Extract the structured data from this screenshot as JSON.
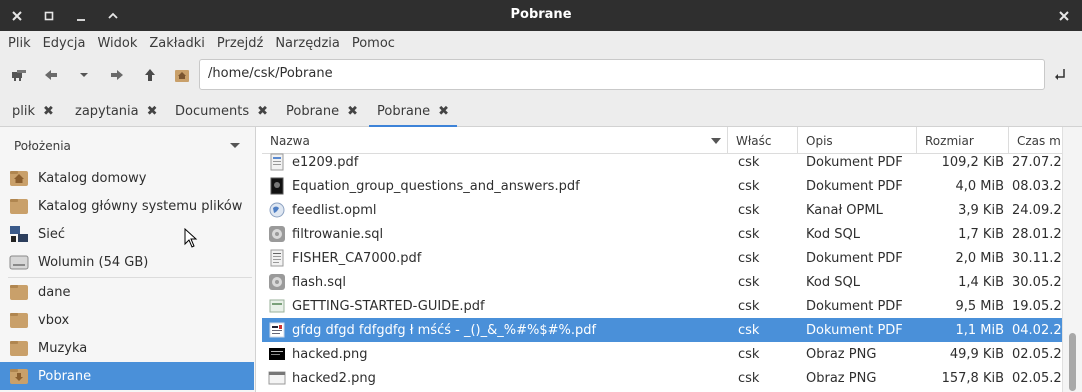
{
  "window": {
    "title": "Pobrane"
  },
  "menu": [
    "Plik",
    "Edycja",
    "Widok",
    "Zakładki",
    "Przejdź",
    "Narzędzia",
    "Pomoc"
  ],
  "location": {
    "path": "/home/csk/Pobrane"
  },
  "tabs": [
    {
      "label": "plik",
      "active": false
    },
    {
      "label": "zapytania",
      "active": false
    },
    {
      "label": "Documents",
      "active": false
    },
    {
      "label": "Pobrane",
      "active": false
    },
    {
      "label": "Pobrane",
      "active": true
    }
  ],
  "sidebar": {
    "header": "Położenia",
    "items": [
      {
        "label": "Katalog domowy",
        "icon": "home-folder-icon"
      },
      {
        "label": "Katalog główny systemu plików",
        "icon": "folder-icon"
      },
      {
        "label": "Sieć",
        "icon": "network-icon"
      },
      {
        "label": "Wolumin (54 GB)",
        "icon": "drive-icon"
      },
      {
        "label": "dane",
        "icon": "folder-icon"
      },
      {
        "label": "vbox",
        "icon": "folder-icon"
      },
      {
        "label": "Muzyka",
        "icon": "folder-icon"
      },
      {
        "label": "Pobrane",
        "icon": "download-folder-icon",
        "selected": true
      }
    ]
  },
  "columns": {
    "name": "Nazwa",
    "owner": "Właśc",
    "desc": "Opis",
    "size": "Rozmiar",
    "date": "Czas m"
  },
  "files": [
    {
      "name": "e1209.pdf",
      "owner": "csk",
      "desc": "Dokument PDF",
      "size": "109,2 KiB",
      "date": "27.07.2",
      "icon": "pdf-icon"
    },
    {
      "name": "Equation_group_questions_and_answers.pdf",
      "owner": "csk",
      "desc": "Dokument PDF",
      "size": "4,0 MiB",
      "date": "08.03.2",
      "icon": "pdf-dark-icon"
    },
    {
      "name": "feedlist.opml",
      "owner": "csk",
      "desc": "Kanał OPML",
      "size": "3,9 KiB",
      "date": "24.09.2",
      "icon": "globe-icon"
    },
    {
      "name": "filtrowanie.sql",
      "owner": "csk",
      "desc": "Kod SQL",
      "size": "1,7 KiB",
      "date": "28.01.2",
      "icon": "sql-icon"
    },
    {
      "name": "FISHER_CA7000.pdf",
      "owner": "csk",
      "desc": "Dokument PDF",
      "size": "2,0 MiB",
      "date": "30.11.2",
      "icon": "pdf-icon"
    },
    {
      "name": "flash.sql",
      "owner": "csk",
      "desc": "Kod SQL",
      "size": "1,4 KiB",
      "date": "30.05.2",
      "icon": "sql-icon"
    },
    {
      "name": "GETTING-STARTED-GUIDE.pdf",
      "owner": "csk",
      "desc": "Dokument PDF",
      "size": "9,5 MiB",
      "date": "19.05.2",
      "icon": "pdf-icon"
    },
    {
      "name": "gfdg  dfgd fdfgdfg ł mśćś - _()_&_%#%$#%.pdf",
      "owner": "csk",
      "desc": "Dokument PDF",
      "size": "1,1 MiB",
      "date": "04.02.2",
      "icon": "pdf-icon",
      "selected": true
    },
    {
      "name": "hacked.png",
      "owner": "csk",
      "desc": "Obraz PNG",
      "size": "49,9 KiB",
      "date": "02.05.2",
      "icon": "image-icon"
    },
    {
      "name": "hacked2.png",
      "owner": "csk",
      "desc": "Obraz PNG",
      "size": "157,8 KiB",
      "date": "02.05.2",
      "icon": "image-icon"
    }
  ],
  "colors": {
    "accent": "#4a90d9",
    "titlebar": "#2f2f2f",
    "chrome": "#ededed"
  }
}
